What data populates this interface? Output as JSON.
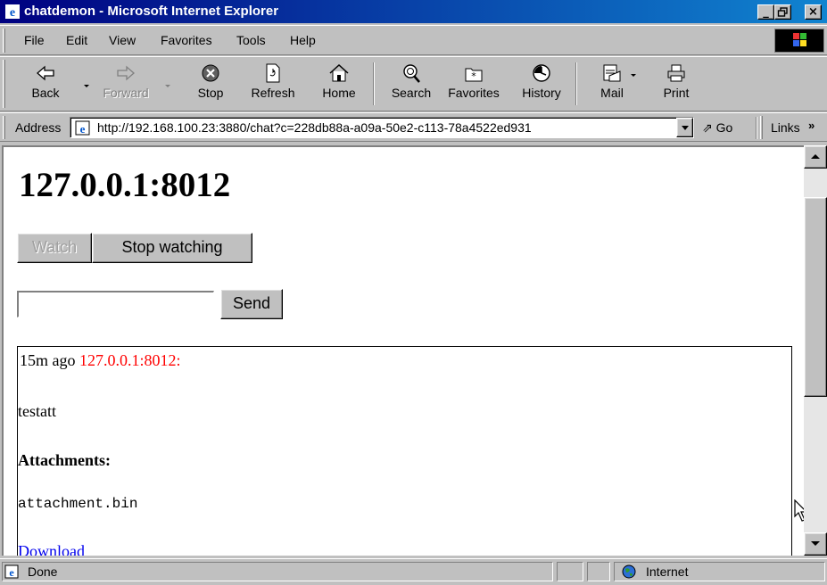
{
  "window": {
    "title": "chatdemon - Microsoft Internet Explorer",
    "controls": {
      "minimize": "_",
      "maximize": "▫",
      "close": "×"
    }
  },
  "menu": [
    "File",
    "Edit",
    "View",
    "Favorites",
    "Tools",
    "Help"
  ],
  "toolbar": {
    "back": "Back",
    "forward": "Forward",
    "stop": "Stop",
    "refresh": "Refresh",
    "home": "Home",
    "search": "Search",
    "favorites": "Favorites",
    "history": "History",
    "mail": "Mail",
    "print": "Print"
  },
  "address": {
    "label": "Address",
    "url": "http://192.168.100.23:3880/chat?c=228db88a-a09a-50e2-c113-78a4522ed931",
    "go": "Go",
    "links": "Links"
  },
  "page": {
    "heading": "127.0.0.1:8012",
    "watch_button": "Watch",
    "stop_watching_button": "Stop watching",
    "message_input_value": "",
    "send_button": "Send",
    "message": {
      "time": "15m ago",
      "sender": "127.0.0.1:8012:",
      "body": "testatt",
      "attachments_heading": "Attachments:",
      "attachment_name": "attachment.bin",
      "download_link": "Download"
    }
  },
  "status": {
    "text": "Done",
    "zone": "Internet"
  },
  "colors": {
    "title_bar": "#000080",
    "sender": "#ff0000",
    "link": "#0000ee",
    "chrome": "#c0c0c0"
  }
}
